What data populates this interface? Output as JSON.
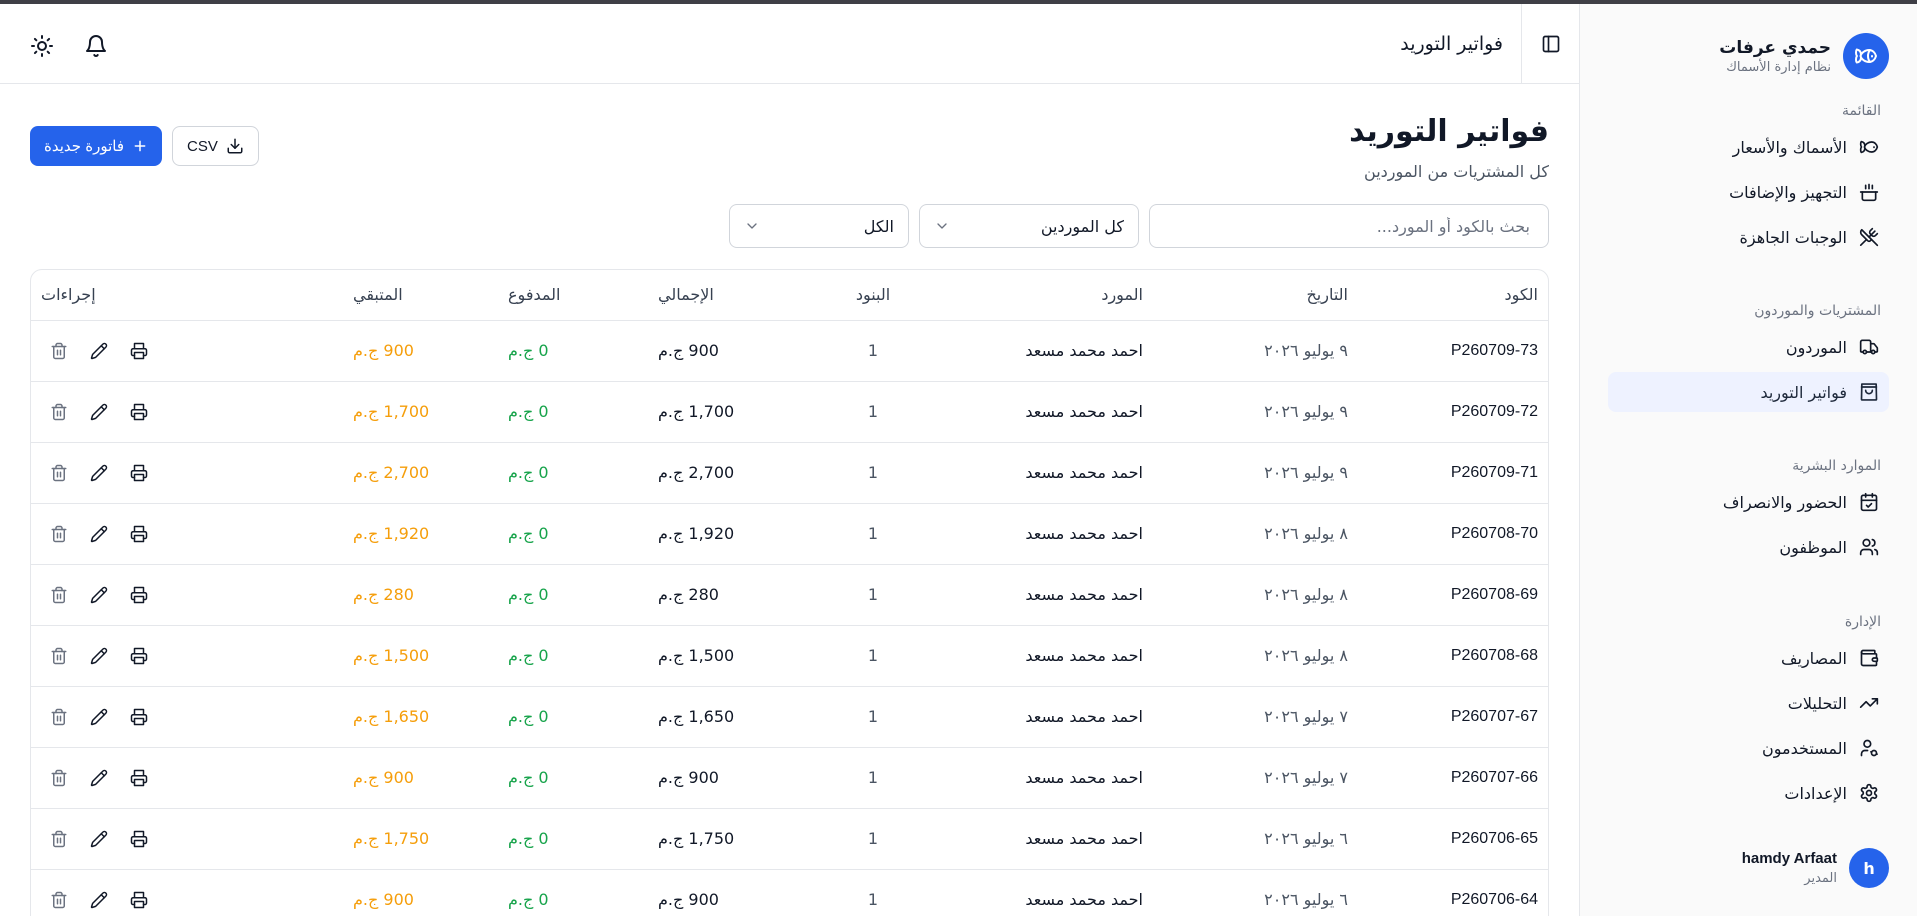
{
  "brand": {
    "name": "حمدي عرفات",
    "subtitle": "نظام إدارة الأسماك"
  },
  "sidebar": {
    "sections": [
      {
        "title": "القائمة",
        "items": [
          {
            "label": "الأسماك والأسعار",
            "icon": "fish-icon"
          },
          {
            "label": "التجهيز والإضافات",
            "icon": "cooking-pot-icon"
          },
          {
            "label": "الوجبات الجاهزة",
            "icon": "utensils-crossed-icon"
          }
        ]
      },
      {
        "title": "المشتريات والموردون",
        "items": [
          {
            "label": "الموردون",
            "icon": "truck-icon"
          },
          {
            "label": "فواتير التوريد",
            "icon": "shopping-bag-icon",
            "active": true
          }
        ]
      },
      {
        "title": "الموارد البشرية",
        "items": [
          {
            "label": "الحضور والانصراف",
            "icon": "calendar-check-icon"
          },
          {
            "label": "الموظفون",
            "icon": "users-icon"
          }
        ]
      },
      {
        "title": "الإدارة",
        "items": [
          {
            "label": "المصاريف",
            "icon": "wallet-icon"
          },
          {
            "label": "التحليلات",
            "icon": "trending-up-icon"
          },
          {
            "label": "المستخدمون",
            "icon": "user-cog-icon"
          },
          {
            "label": "الإعدادات",
            "icon": "gear-icon"
          }
        ]
      }
    ]
  },
  "user": {
    "name": "hamdy Arfaat",
    "role": "المدير",
    "initial": "h"
  },
  "header": {
    "title": "فواتير التوريد"
  },
  "page": {
    "title": "فواتير التوريد",
    "subtitle": "كل المشتريات من الموردين"
  },
  "actions": {
    "new_invoice": "فاتورة جديدة",
    "csv": "CSV"
  },
  "filters": {
    "search_placeholder": "بحث بالكود أو المورد...",
    "supplier": "كل الموردين",
    "status": "الكل"
  },
  "table": {
    "headers": {
      "code": "الكود",
      "date": "التاريخ",
      "supplier": "المورد",
      "items": "البنود",
      "total": "الإجمالي",
      "paid": "المدفوع",
      "remaining": "المتبقي",
      "actions": "إجراءات"
    },
    "rows": [
      {
        "code": "P260709-73",
        "date": "٩ يوليو ٢٠٢٦",
        "supplier": "احمد محمد مسعد",
        "items": "1",
        "total": "900 ج.م",
        "paid": "0 ج.م",
        "remaining": "900 ج.م"
      },
      {
        "code": "P260709-72",
        "date": "٩ يوليو ٢٠٢٦",
        "supplier": "احمد محمد مسعد",
        "items": "1",
        "total": "1,700 ج.م",
        "paid": "0 ج.م",
        "remaining": "1,700 ج.م"
      },
      {
        "code": "P260709-71",
        "date": "٩ يوليو ٢٠٢٦",
        "supplier": "احمد محمد مسعد",
        "items": "1",
        "total": "2,700 ج.م",
        "paid": "0 ج.م",
        "remaining": "2,700 ج.م"
      },
      {
        "code": "P260708-70",
        "date": "٨ يوليو ٢٠٢٦",
        "supplier": "احمد محمد مسعد",
        "items": "1",
        "total": "1,920 ج.م",
        "paid": "0 ج.م",
        "remaining": "1,920 ج.م"
      },
      {
        "code": "P260708-69",
        "date": "٨ يوليو ٢٠٢٦",
        "supplier": "احمد محمد مسعد",
        "items": "1",
        "total": "280 ج.م",
        "paid": "0 ج.م",
        "remaining": "280 ج.م"
      },
      {
        "code": "P260708-68",
        "date": "٨ يوليو ٢٠٢٦",
        "supplier": "احمد محمد مسعد",
        "items": "1",
        "total": "1,500 ج.م",
        "paid": "0 ج.م",
        "remaining": "1,500 ج.م"
      },
      {
        "code": "P260707-67",
        "date": "٧ يوليو ٢٠٢٦",
        "supplier": "احمد محمد مسعد",
        "items": "1",
        "total": "1,650 ج.م",
        "paid": "0 ج.م",
        "remaining": "1,650 ج.م"
      },
      {
        "code": "P260707-66",
        "date": "٧ يوليو ٢٠٢٦",
        "supplier": "احمد محمد مسعد",
        "items": "1",
        "total": "900 ج.م",
        "paid": "0 ج.م",
        "remaining": "900 ج.م"
      },
      {
        "code": "P260706-65",
        "date": "٦ يوليو ٢٠٢٦",
        "supplier": "احمد محمد مسعد",
        "items": "1",
        "total": "1,750 ج.م",
        "paid": "0 ج.م",
        "remaining": "1,750 ج.م"
      },
      {
        "code": "P260706-64",
        "date": "٦ يوليو ٢٠٢٦",
        "supplier": "احمد محمد مسعد",
        "items": "1",
        "total": "900 ج.م",
        "paid": "0 ج.م",
        "remaining": "900 ج.م"
      }
    ]
  },
  "colors": {
    "accent": "#2563eb",
    "paid": "#16a34a",
    "remaining": "#f59e0b",
    "active_nav": "#eef2ff"
  }
}
